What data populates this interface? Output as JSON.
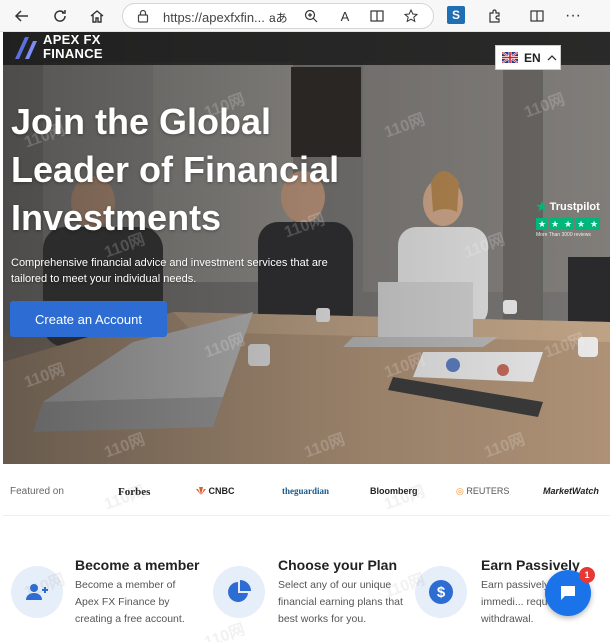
{
  "browser": {
    "url": "https://apexfxfin...",
    "read_aloud_label": "aあ"
  },
  "header": {
    "logo_line1": "APEX FX",
    "logo_line2": "FINANCE",
    "language": "EN"
  },
  "hero": {
    "title": "Join the Global Leader of Financial Investments",
    "subtitle": "Comprehensive financial advice and investment services that are tailored to meet your individual needs.",
    "cta_label": "Create an Account",
    "trustpilot_name": "Trustpilot",
    "trustpilot_reviews": "More Than 3000 reviews"
  },
  "featured": {
    "label": "Featured on",
    "brands": [
      "Forbes",
      "CNBC",
      "theguardian",
      "Bloomberg",
      "REUTERS",
      "MarketWatch"
    ]
  },
  "features": [
    {
      "title": "Become a member",
      "desc": "Become a member of Apex FX Finance by creating a free account.",
      "icon": "add-user-icon"
    },
    {
      "title": "Choose your Plan",
      "desc": "Select any of our unique financial earning plans that best works for you.",
      "icon": "pie-chart-icon"
    },
    {
      "title": "Earn Passively",
      "desc": "Earn passively... paid immedi... request for a withdrawal.",
      "icon": "dollar-icon"
    }
  ],
  "chat": {
    "badge_count": "1"
  },
  "watermark": "110网",
  "colors": {
    "accent": "#2d6cd3",
    "trustpilot": "#00b67a",
    "chat": "#1a73e8",
    "badge": "#e53935"
  }
}
